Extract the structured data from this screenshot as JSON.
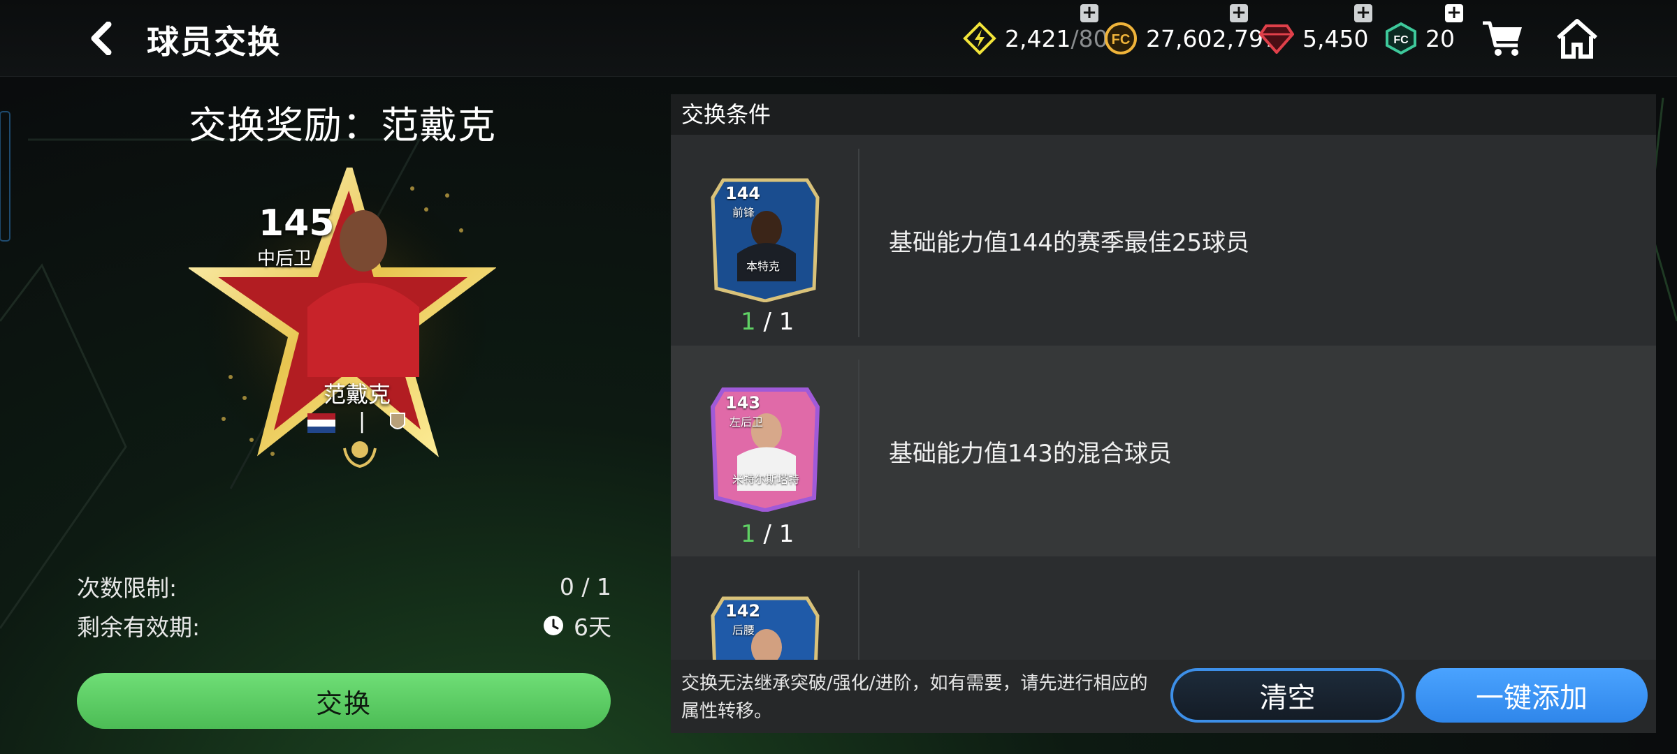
{
  "header": {
    "title": "球员交换",
    "back_icon": "chevron-left-icon"
  },
  "currencies": [
    {
      "name": "energy",
      "icon": "lightning-icon",
      "value": "2,421",
      "max": "/80",
      "color": "#f2e43a"
    },
    {
      "name": "coins",
      "icon": "fc-coin-icon",
      "value": "27,602,797",
      "color": "#f0b43a"
    },
    {
      "name": "gems",
      "icon": "gem-icon",
      "value": "5,450",
      "color": "#e0404a"
    },
    {
      "name": "points",
      "icon": "fc-points-icon",
      "value": "20",
      "color": "#3ec99b"
    }
  ],
  "nav": {
    "cart_icon": "shopping-cart-icon",
    "home_icon": "home-icon"
  },
  "reward": {
    "title": "交换奖励：范戴克",
    "card": {
      "rating": "145",
      "position": "中后卫",
      "name": "范戴克",
      "separator": "|"
    }
  },
  "limits": {
    "count_label": "次数限制:",
    "count_value": "0 / 1",
    "expiry_label": "剩余有效期:",
    "expiry_value": "6天"
  },
  "exchange_button": "交换",
  "conditions": {
    "header": "交换条件",
    "items": [
      {
        "requirement": "基础能力值144的赛季最佳25球员",
        "have": "1",
        "need": "/ 1",
        "card_rating": "144",
        "card_pos": "前锋",
        "card_name": "本特克"
      },
      {
        "requirement": "基础能力值143的混合球员",
        "have": "1",
        "need": "/ 1",
        "card_rating": "143",
        "card_pos": "左后卫",
        "card_name": "米特尔斯塔特"
      },
      {
        "requirement": "",
        "card_rating": "142",
        "card_pos": "后腰"
      }
    ]
  },
  "footer": {
    "notice": "交换无法继承突破/强化/进阶，如有需要，请先进行相应的属性转移。",
    "clear_button": "清空",
    "add_button": "一键添加"
  },
  "colors": {
    "accent_green": "#5fd064",
    "accent_blue": "#3d8fe8"
  }
}
